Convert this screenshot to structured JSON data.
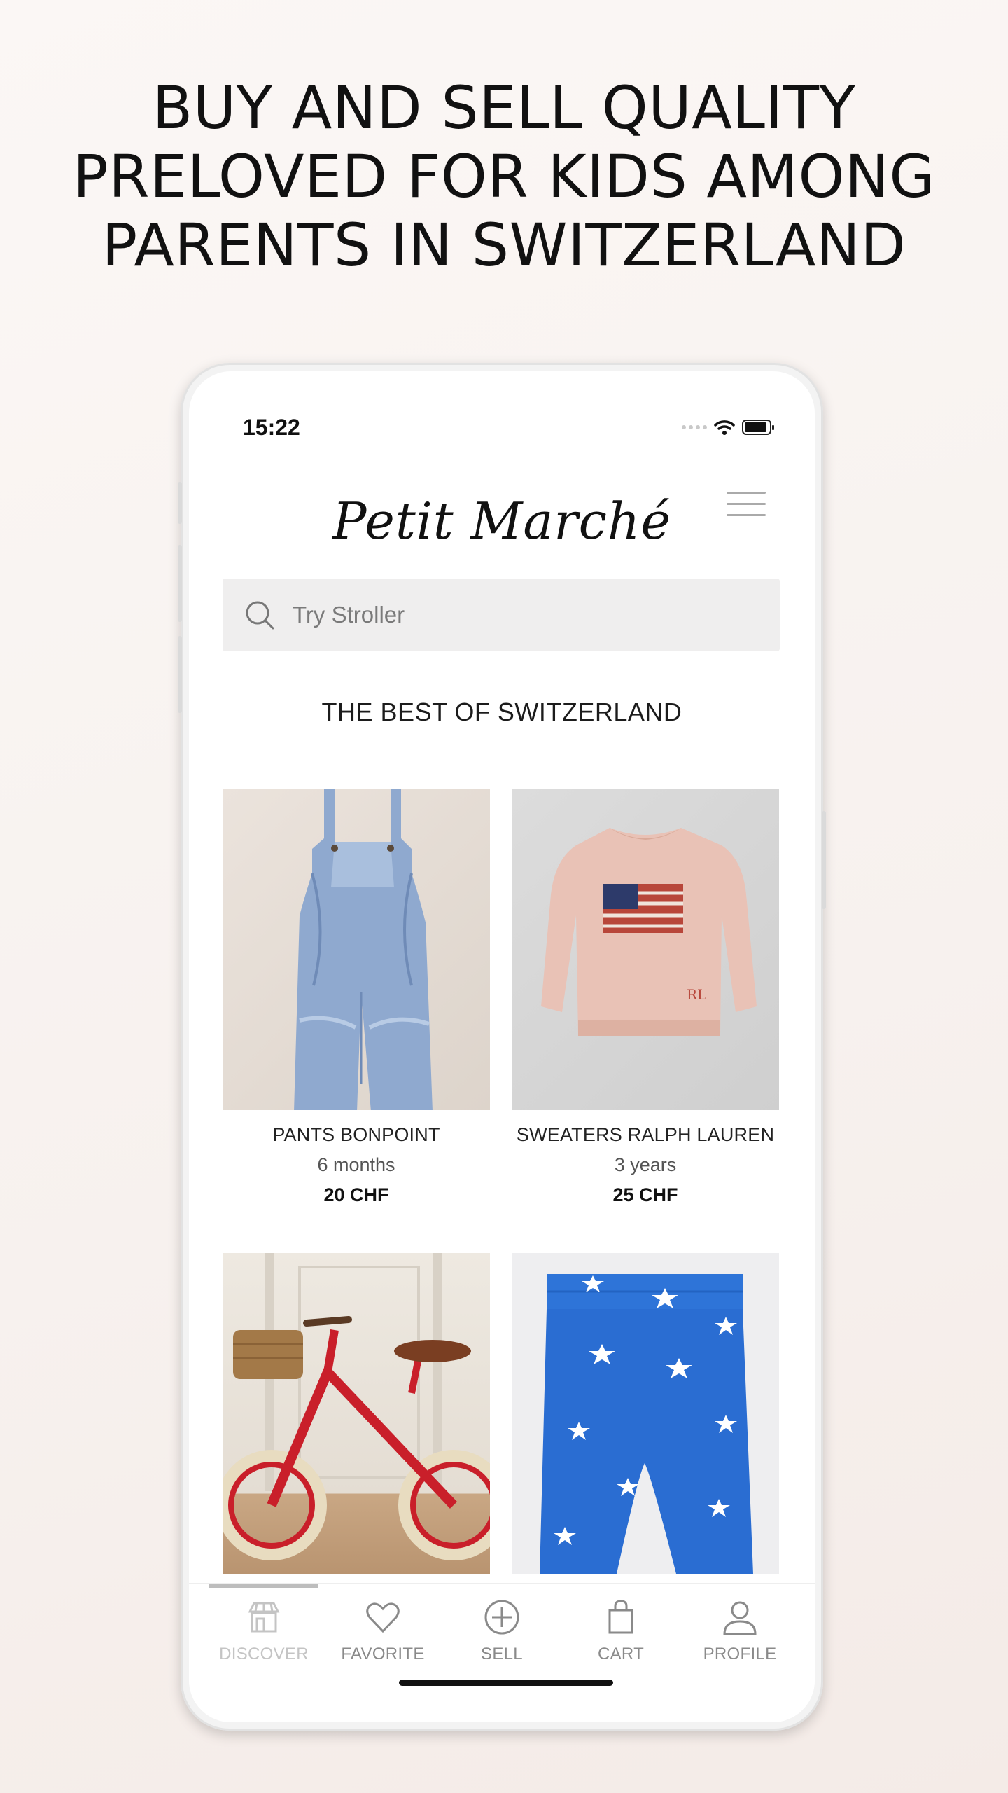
{
  "headline": {
    "line1": "BUY AND SELL QUALITY",
    "line2": "PRELOVED FOR KIDS AMONG",
    "line3": "PARENTS IN SWITZERLAND"
  },
  "status_bar": {
    "time": "15:22"
  },
  "app": {
    "logo": "Petit Marché"
  },
  "search": {
    "placeholder": "Try Stroller"
  },
  "section_title": "THE BEST OF SWITZERLAND",
  "products": [
    {
      "name": "PANTS BONPOINT",
      "size": "6 months",
      "price": "20 CHF"
    },
    {
      "name": "SWEATERS RALPH LAUREN",
      "size": "3 years",
      "price": "25 CHF"
    },
    {
      "name": "",
      "size": "",
      "price": ""
    },
    {
      "name": "",
      "size": "",
      "price": ""
    }
  ],
  "tabs": [
    {
      "label": "DISCOVER",
      "icon": "shop-icon",
      "active": true
    },
    {
      "label": "FAVORITE",
      "icon": "heart-icon",
      "active": false
    },
    {
      "label": "SELL",
      "icon": "plus-circle-icon",
      "active": false
    },
    {
      "label": "CART",
      "icon": "bag-icon",
      "active": false
    },
    {
      "label": "PROFILE",
      "icon": "user-icon",
      "active": false
    }
  ],
  "colors": {
    "background": "#f7f1ee",
    "search_bg": "#efeeee",
    "tab_inactive": "#8a8a8a",
    "tab_active": "#c4c4c4"
  }
}
